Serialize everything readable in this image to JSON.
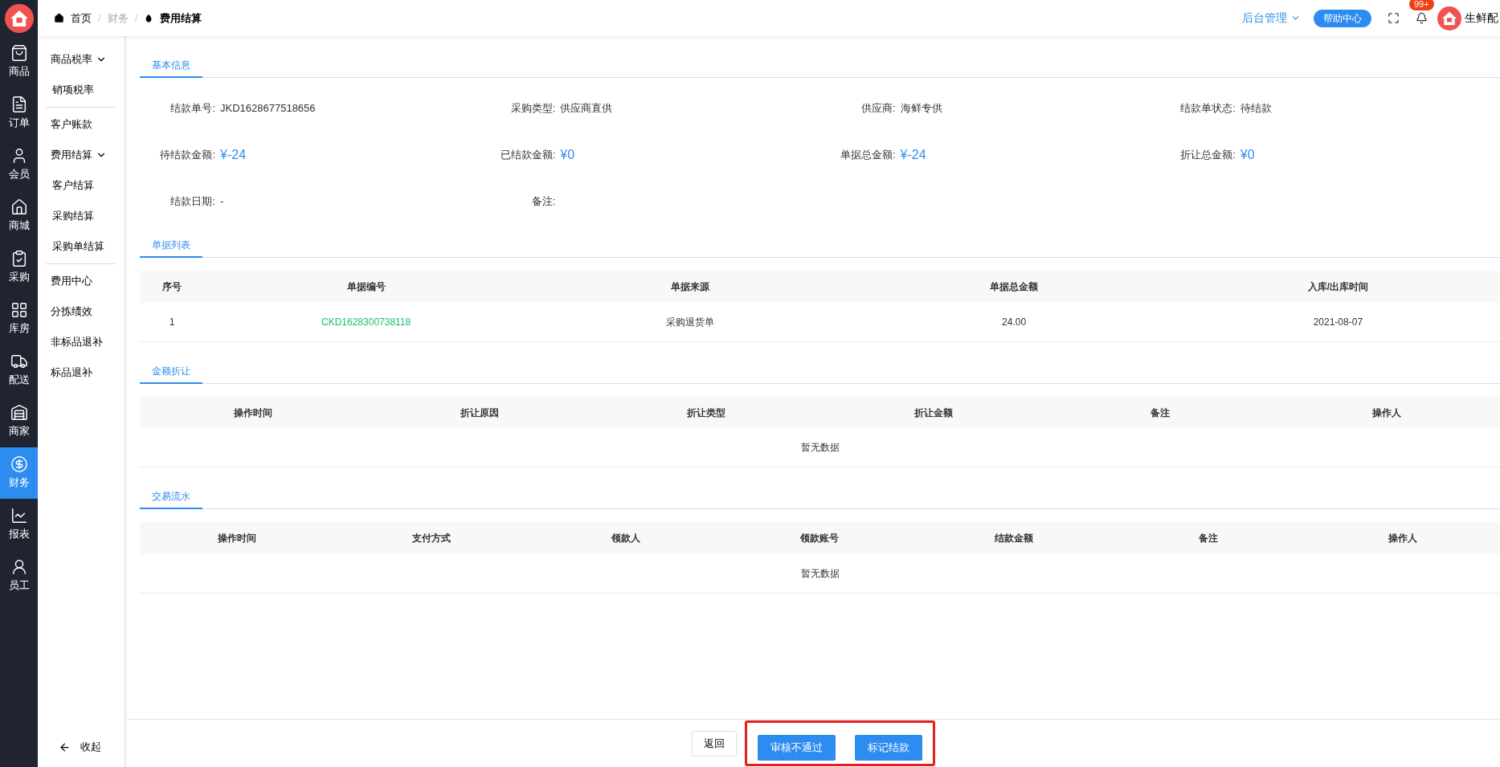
{
  "breadcrumb_separator": "/",
  "breadcrumb": [
    {
      "label": "首页",
      "kind": "home"
    },
    {
      "label": "财务",
      "kind": "plain"
    },
    {
      "label": "费用结算",
      "kind": "current"
    }
  ],
  "header": {
    "menu": "后台管理",
    "help": "帮助中心",
    "badge": "99+",
    "user": "生鲜配"
  },
  "nav": [
    {
      "label": "商品",
      "selected": false
    },
    {
      "label": "订单",
      "selected": false
    },
    {
      "label": "会员",
      "selected": false
    },
    {
      "label": "商城",
      "selected": false
    },
    {
      "label": "采购",
      "selected": false
    },
    {
      "label": "库房",
      "selected": false
    },
    {
      "label": "配送",
      "selected": false
    },
    {
      "label": "商家",
      "selected": false
    },
    {
      "label": "财务",
      "selected": true
    },
    {
      "label": "报表",
      "selected": false
    },
    {
      "label": "员工",
      "selected": false
    }
  ],
  "submenu": [
    [
      {
        "label": "商品税率",
        "expanded": true,
        "children": [
          {
            "label": "销项税率"
          }
        ]
      }
    ],
    [
      {
        "label": "客户账款"
      },
      {
        "label": "费用结算",
        "expanded": true,
        "children": [
          {
            "label": "客户结算"
          },
          {
            "label": "采购结算"
          },
          {
            "label": "采购单结算"
          }
        ]
      }
    ],
    [
      {
        "label": "费用中心"
      },
      {
        "label": "分拣绩效"
      },
      {
        "label": "非标品退补"
      },
      {
        "label": "标品退补"
      }
    ]
  ],
  "collapse": "收起",
  "basic_info": {
    "tab": "基本信息",
    "fields": [
      {
        "label": "结款单号:",
        "value": "JKD1628677518656",
        "kind": "text"
      },
      {
        "label": "采购类型:",
        "value": "供应商直供",
        "kind": "text"
      },
      {
        "label": "供应商:",
        "value": "海鲜专供",
        "kind": "text"
      },
      {
        "label": "结款单状态:",
        "value": "待结款",
        "kind": "text"
      },
      {
        "label": "待结款金额:",
        "value": "¥-24",
        "kind": "amount"
      },
      {
        "label": "已结款金额:",
        "value": "¥0",
        "kind": "amount"
      },
      {
        "label": "单据总金额:",
        "value": "¥-24",
        "kind": "amount"
      },
      {
        "label": "折让总金额:",
        "value": "¥0",
        "kind": "amount"
      },
      {
        "label": "结款日期:",
        "value": "-",
        "kind": "text"
      },
      {
        "label": "备注:"
      }
    ]
  },
  "tables": [
    {
      "tab": "单据列表",
      "columns": [
        "序号",
        "单据编号",
        "单据来源",
        "单据总金额",
        "入库/出库时间"
      ],
      "rows": [
        [
          "1",
          "CKD1628300738118",
          "采购退货单",
          "24.00",
          "2021-08-07"
        ]
      ]
    },
    {
      "tab": "金额折让",
      "columns": [
        "操作时间",
        "折让原因",
        "折让类型",
        "折让金额",
        "备注",
        "操作人"
      ],
      "empty": "暂无数据"
    },
    {
      "tab": "交易流水",
      "columns": [
        "操作时间",
        "支付方式",
        "领款人",
        "领款账号",
        "结款金额",
        "备注",
        "操作人"
      ],
      "empty": "暂无数据"
    }
  ],
  "footer": {
    "back": "返回",
    "reject": "审核不通过",
    "mark": "标记结款"
  }
}
